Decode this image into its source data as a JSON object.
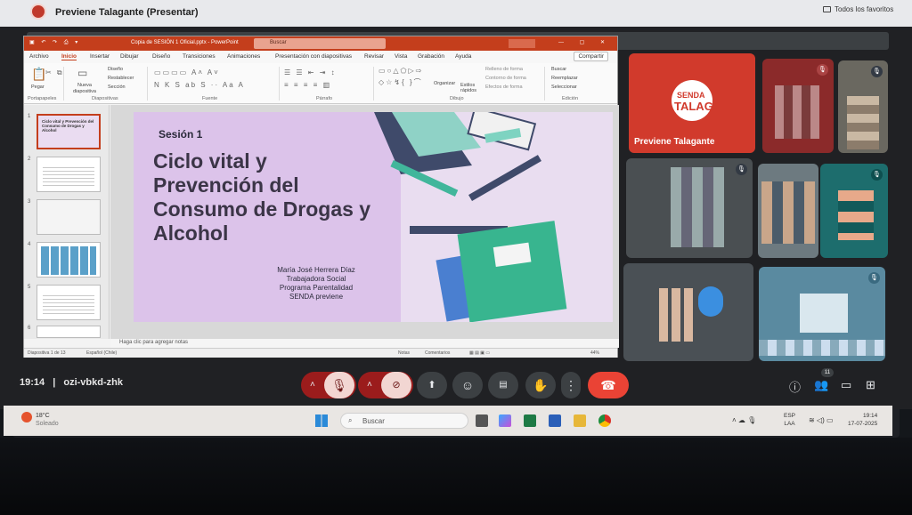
{
  "chrome": {
    "tab_title": "Previene Talagante (Presentar)",
    "bookmarks_label": "Todos los favoritos"
  },
  "powerpoint": {
    "doc_title": "Copia de SESIÓN 1 Oficial.pptx  -  PowerPoint",
    "search_placeholder": "Buscar",
    "menu": [
      "Archivo",
      "Inicio",
      "Insertar",
      "Dibujar",
      "Diseño",
      "Transiciones",
      "Animaciones",
      "Presentación con diapositivas",
      "Revisar",
      "Vista",
      "Grabación",
      "Ayuda"
    ],
    "active_menu": "Inicio",
    "share_label": "Compartir",
    "ribbon": {
      "paste": "Pegar",
      "new_slide": "Nueva diapositiva",
      "layout": "Diseño",
      "reset": "Restablecer",
      "section": "Sección",
      "organize": "Organizar",
      "styles": "Estilos rápidos",
      "fill": "Relleno de forma",
      "outline": "Contorno de forma",
      "effects": "Efectos de forma",
      "find": "Buscar",
      "replace": "Reemplazar",
      "select": "Seleccionar",
      "groups": [
        "Portapapeles",
        "Diapositivas",
        "Fuente",
        "Párrafo",
        "Dibujo",
        "Edición"
      ]
    },
    "slide": {
      "session": "Sesión 1",
      "title": "Ciclo vital y Prevención del Consumo de Drogas y Alcohol",
      "author_lines": [
        "María José Herrera Díaz",
        "Trabajadora Social",
        "Programa Parentalidad",
        "SENDA previene"
      ]
    },
    "thumbnail_numbers": [
      "1",
      "2",
      "3",
      "4",
      "5",
      "6"
    ],
    "thumb1_text": "Ciclo vital y Prevención del Consumo de Drogas y Alcohol",
    "notes_placeholder": "Haga clic para agregar notas",
    "status": {
      "slide_count": "Diapositiva 1 de 13",
      "language": "Español (Chile)",
      "notes": "Notas",
      "comments": "Comentarios",
      "zoom": "44%"
    }
  },
  "participants": {
    "presenter_name": "Previene Talagante",
    "logo_top": "SENDA",
    "logo_bottom": "TALAG"
  },
  "meet_bar": {
    "time": "19:14",
    "separator": "|",
    "meeting_code": "ozi-vbkd-zhk",
    "participant_count": "11",
    "icons": [
      "chevron-up-icon",
      "mic-off-icon",
      "chevron-up-icon",
      "camera-off-icon",
      "present-icon",
      "emoji-icon",
      "captions-icon",
      "raise-hand-icon",
      "more-icon",
      "end-call-icon"
    ]
  },
  "taskbar": {
    "temperature": "18°C",
    "weather": "Soleado",
    "search_placeholder": "Buscar",
    "lang_top": "ESP",
    "lang_bottom": "LAA",
    "clock_time": "19:14",
    "clock_date": "17-07-2025"
  },
  "colors": {
    "ppt_accent": "#c43e1c",
    "meet_bg": "#202124",
    "end_call": "#ea4335",
    "senda_red": "#d13a2c"
  }
}
